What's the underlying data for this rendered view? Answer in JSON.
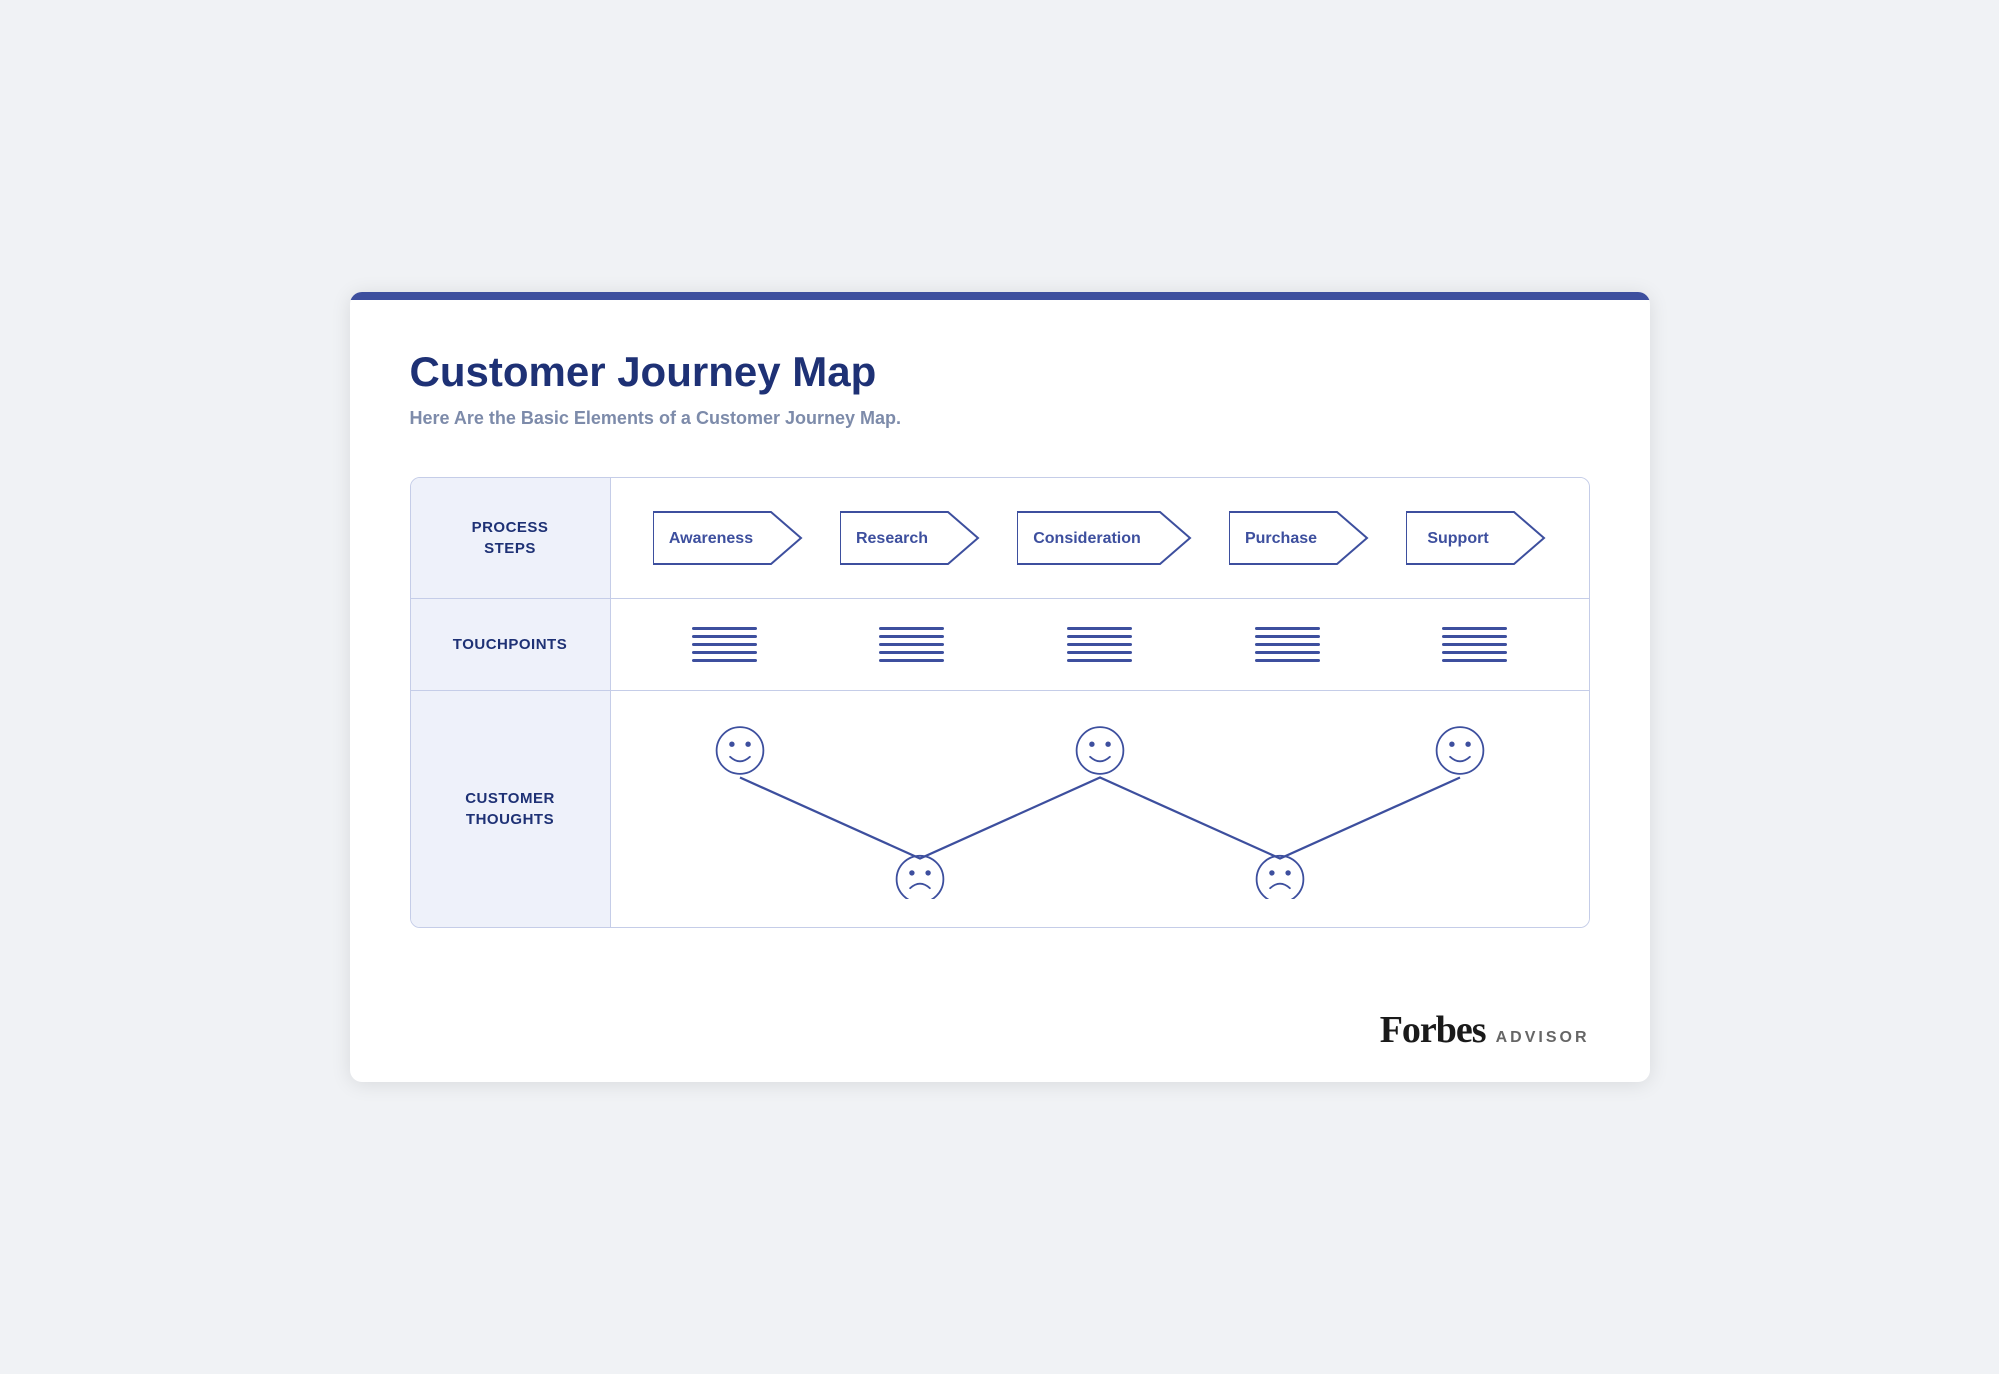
{
  "card": {
    "title": "Customer Journey Map",
    "subtitle": "Here Are the Basic Elements of a Customer Journey Map.",
    "top_bar_color": "#3d4f9e"
  },
  "table": {
    "rows": [
      {
        "id": "process-steps",
        "label": "PROCESS\nSTEPS",
        "steps": [
          "Awareness",
          "Research",
          "Consideration",
          "Purchase",
          "Support"
        ]
      },
      {
        "id": "touchpoints",
        "label": "TOUCHPOINTS"
      },
      {
        "id": "customer-thoughts",
        "label": "CUSTOMER\nTHOUGHTS"
      }
    ]
  },
  "footer": {
    "brand": "Forbes",
    "sub": "ADVISOR"
  },
  "colors": {
    "primary": "#1e3175",
    "accent": "#3d4f9e",
    "label_bg": "#eef1fa",
    "border": "#c5cde8"
  }
}
